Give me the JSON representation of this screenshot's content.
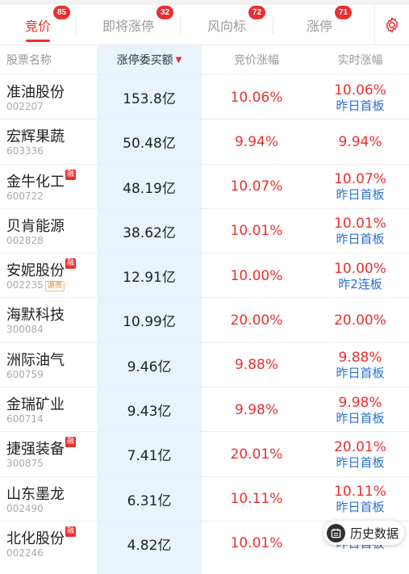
{
  "tabs": [
    {
      "label": "竞价",
      "badge": "85",
      "active": true
    },
    {
      "label": "即将涨停",
      "badge": "32",
      "active": false
    },
    {
      "label": "风向标",
      "badge": "72",
      "active": false
    },
    {
      "label": "涨停",
      "badge": "71",
      "active": false
    }
  ],
  "header": {
    "name": "股票名称",
    "amount": "涨停委买额",
    "sort_arrow": "▼",
    "bid_change": "竞价涨幅",
    "realtime_change": "实时涨幅"
  },
  "rows": [
    {
      "name": "准油股份",
      "code": "002207",
      "rong": "",
      "youzi": "",
      "amount": "153.8亿",
      "bid": "10.06%",
      "rt": "10.06%",
      "rt_sub": "昨日首板"
    },
    {
      "name": "宏辉果蔬",
      "code": "603336",
      "rong": "",
      "youzi": "",
      "amount": "50.48亿",
      "bid": "9.94%",
      "rt": "9.94%",
      "rt_sub": ""
    },
    {
      "name": "金牛化工",
      "code": "600722",
      "rong": "融",
      "youzi": "",
      "amount": "48.19亿",
      "bid": "10.07%",
      "rt": "10.07%",
      "rt_sub": "昨日首板"
    },
    {
      "name": "贝肯能源",
      "code": "002828",
      "rong": "",
      "youzi": "",
      "amount": "38.62亿",
      "bid": "10.01%",
      "rt": "10.01%",
      "rt_sub": "昨日首板"
    },
    {
      "name": "安妮股份",
      "code": "002235",
      "rong": "融",
      "youzi": "游资",
      "amount": "12.91亿",
      "bid": "10.00%",
      "rt": "10.00%",
      "rt_sub": "昨2连板"
    },
    {
      "name": "海默科技",
      "code": "300084",
      "rong": "",
      "youzi": "",
      "amount": "10.99亿",
      "bid": "20.00%",
      "rt": "20.00%",
      "rt_sub": ""
    },
    {
      "name": "洲际油气",
      "code": "600759",
      "rong": "",
      "youzi": "",
      "amount": "9.46亿",
      "bid": "9.88%",
      "rt": "9.88%",
      "rt_sub": "昨日首板"
    },
    {
      "name": "金瑞矿业",
      "code": "600714",
      "rong": "",
      "youzi": "",
      "amount": "9.43亿",
      "bid": "9.98%",
      "rt": "9.98%",
      "rt_sub": "昨日首板"
    },
    {
      "name": "捷强装备",
      "code": "300875",
      "rong": "融",
      "youzi": "",
      "amount": "7.41亿",
      "bid": "20.01%",
      "rt": "20.01%",
      "rt_sub": "昨日首板"
    },
    {
      "name": "山东墨龙",
      "code": "002490",
      "rong": "",
      "youzi": "",
      "amount": "6.31亿",
      "bid": "10.11%",
      "rt": "10.11%",
      "rt_sub": "昨日首板"
    },
    {
      "name": "北化股份",
      "code": "002246",
      "rong": "融",
      "youzi": "",
      "amount": "4.82亿",
      "bid": "10.01%",
      "rt": "",
      "rt_sub": "昨日首板"
    }
  ],
  "history_button": {
    "label": "历史数据",
    "icon": "calendar-icon"
  },
  "colors": {
    "accent": "#e93030",
    "blue": "#2b6fd6",
    "sort_column_bg": "#e8f3fd"
  }
}
